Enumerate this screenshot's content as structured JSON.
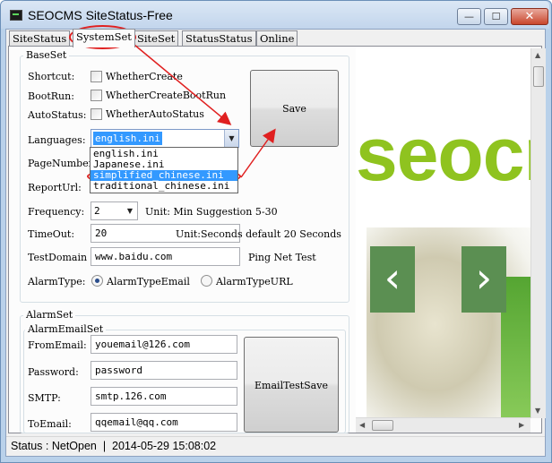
{
  "window": {
    "title": "SEOCMS SiteStatus-Free",
    "min_glyph": "—",
    "max_glyph": "☐",
    "close_glyph": "✕"
  },
  "tabs": [
    {
      "label": "SiteStatus",
      "active": false
    },
    {
      "label": "SystemSet",
      "active": true
    },
    {
      "label": "SiteSet",
      "active": false
    },
    {
      "label": "StatusStatus",
      "active": false
    },
    {
      "label": "Online",
      "active": false
    }
  ],
  "baseset": {
    "title": "BaseSet",
    "shortcut": {
      "label": "Shortcut:",
      "check_label": "WhetherCreate",
      "checked": false
    },
    "bootrun": {
      "label": "BootRun:",
      "check_label": "WhetherCreateBootRun",
      "checked": false
    },
    "autostatus": {
      "label": "AutoStatus:",
      "check_label": "WhetherAutoStatus",
      "checked": false
    },
    "languages": {
      "label": "Languages:",
      "value": "english.ini",
      "options": [
        "english.ini",
        "Japanese.ini",
        "simplified_chinese.ini",
        "traditional_chinese.ini"
      ],
      "highlighted": "simplified_chinese.ini"
    },
    "pagenumber": {
      "label": "PageNumber:"
    },
    "reporturl": {
      "label": "ReportUrl:"
    },
    "frequency": {
      "label": "Frequency:",
      "value": "2",
      "hint": "Unit: Min Suggestion 5-30"
    },
    "timeout": {
      "label": "TimeOut:",
      "value": "20",
      "hint": "Unit:Seconds default 20 Seconds"
    },
    "testdomain": {
      "label": "TestDomain",
      "value": "www.baidu.com",
      "hint": "Ping Net Test"
    },
    "alarmtype": {
      "label": "AlarmType:",
      "options": [
        {
          "label": "AlarmTypeEmail",
          "selected": true
        },
        {
          "label": "AlarmTypeURL",
          "selected": false
        }
      ]
    },
    "save_label": "Save"
  },
  "alarmset": {
    "title": "AlarmSet",
    "email_group_title": "AlarmEmailSet",
    "fromemail": {
      "label": "FromEmail:",
      "value": "youemail@126.com"
    },
    "password": {
      "label": "Password:",
      "value": "password"
    },
    "smtp": {
      "label": "SMTP:",
      "value": "smtp.126.com"
    },
    "toemail": {
      "label": "ToEmail:",
      "value": "qqemail@qq.com"
    },
    "test_save_label": "EmailTestSave"
  },
  "preview": {
    "brand_text": "seocr",
    "prev_glyph": "‹",
    "next_glyph": "›"
  },
  "scroll": {
    "up": "▲",
    "down": "▼",
    "left": "◀",
    "right": "▶"
  },
  "status": {
    "text": "Status : NetOpen  |  2014-05-29 15:08:02"
  },
  "colors": {
    "brand_green": "#8fc31f",
    "annotation_red": "#e02020",
    "selection_blue": "#3399ff"
  }
}
